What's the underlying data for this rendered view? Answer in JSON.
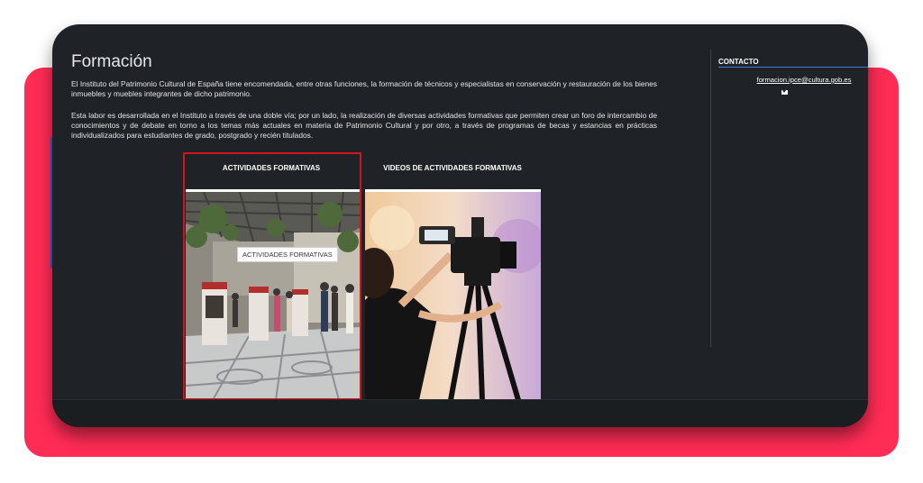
{
  "page": {
    "title": "Formación",
    "paragraphs": [
      "El Instituto del Patrimonio Cultural de España tiene encomendada, entre otras funciones, la formación de técnicos y especialistas en conservación y restauración de los bienes inmuebles y muebles integrantes de dicho patrimonio.",
      "Esta labor es desarrollada en el Instituto a través de una doble vía; por un lado, la realización de diversas actividades formativas que permiten crear un foro de intercambio de conocimientos y de debate en torno a los temas más actuales en materia de Patrimonio Cultural y por otro, a través de programas de becas y estancias en prácticas individualizados para estudiantes de grado, postgrado y recién titulados."
    ]
  },
  "tabs": [
    {
      "label": "ACTIVIDADES FORMATIVAS",
      "caption": "ACTIVIDADES FORMATIVAS"
    },
    {
      "label": "VIDEOS DE ACTIVIDADES FORMATIVAS"
    }
  ],
  "sidebar": {
    "heading": "CONTACTO",
    "email": "formacion.ipce@cultura.gob.es",
    "icon": "mail-icon"
  },
  "colors": {
    "accent_background": "#ff2c55",
    "page_background": "#1f2226",
    "highlight_frame": "#d4141a",
    "sidebar_toggle": "#1f66c0"
  }
}
